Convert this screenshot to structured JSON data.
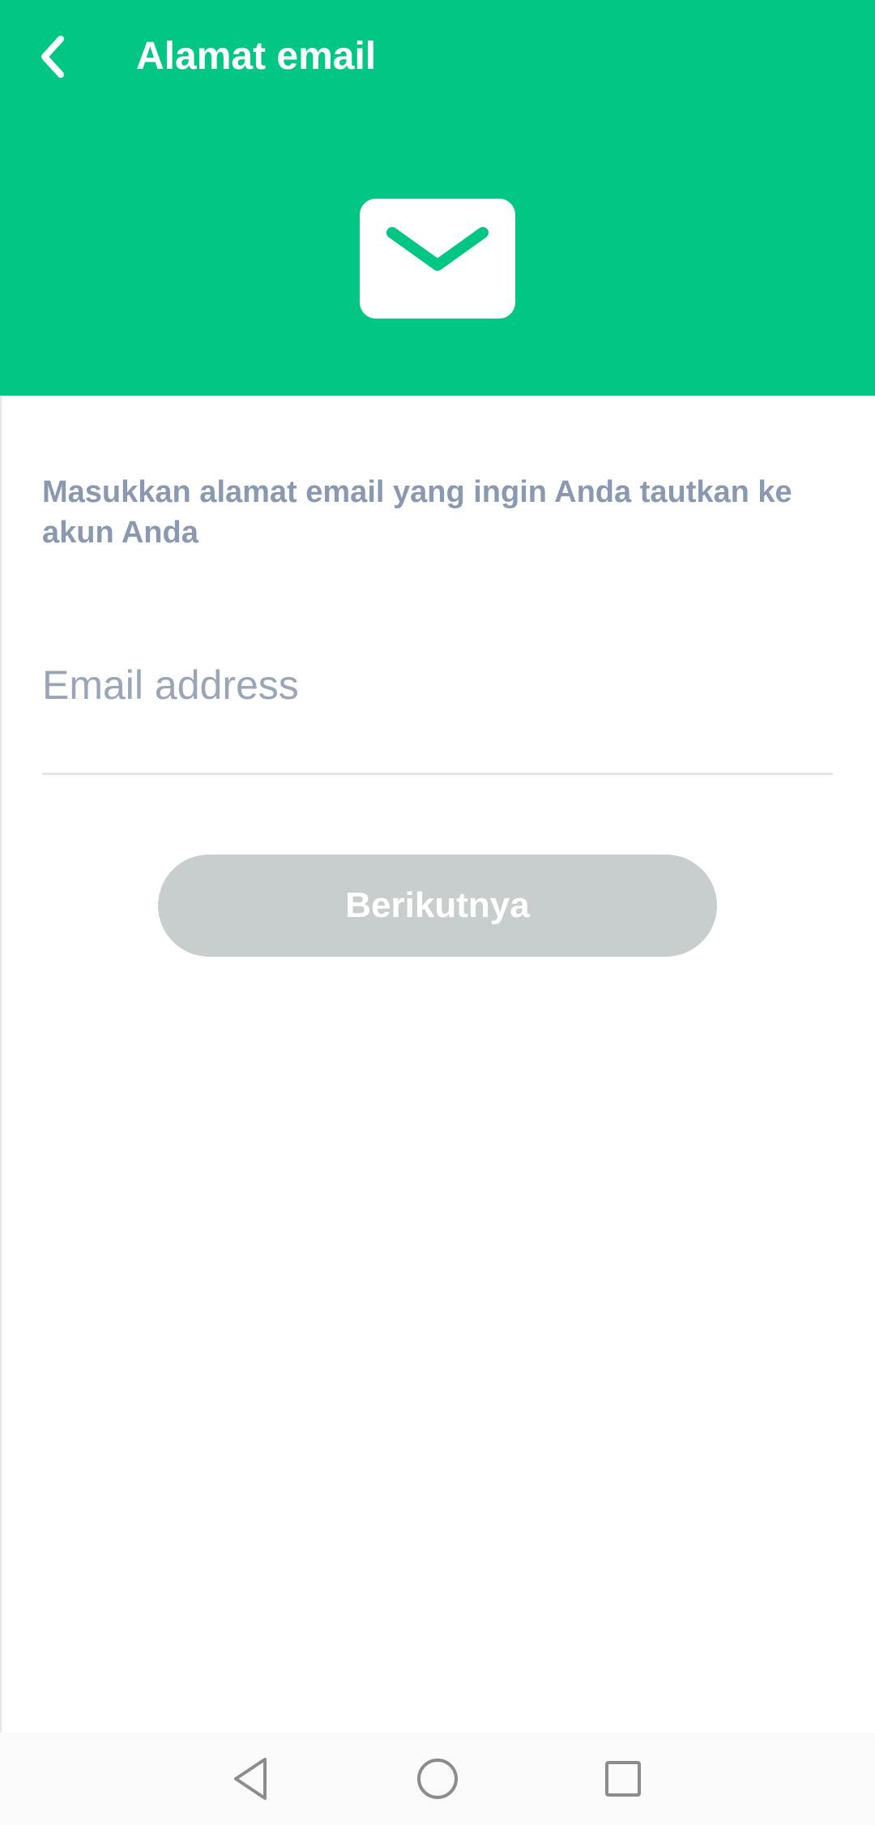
{
  "header": {
    "title": "Alamat email",
    "back_icon": "chevron-left-icon",
    "hero_icon": "envelope-icon",
    "background_color": "#02c784"
  },
  "main": {
    "description": "Masukkan alamat email yang ingin Anda tautkan ke akun Anda",
    "email_input": {
      "value": "",
      "placeholder": "Email address"
    },
    "next_button_label": "Berikutnya",
    "next_button_color": "#c8cecd"
  },
  "system_nav": {
    "back_icon": "triangle-back-icon",
    "home_icon": "circle-home-icon",
    "recents_icon": "square-recents-icon"
  }
}
